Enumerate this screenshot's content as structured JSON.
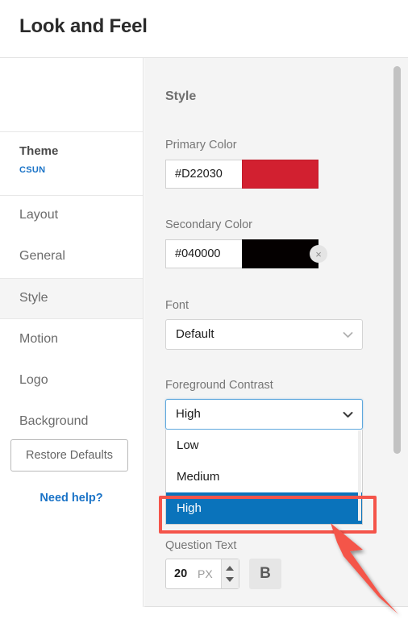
{
  "header": {
    "title": "Look and Feel"
  },
  "sidebar": {
    "theme": {
      "label": "Theme",
      "value": "CSUN"
    },
    "items": [
      {
        "label": "Layout",
        "selected": false
      },
      {
        "label": "General",
        "selected": false
      },
      {
        "label": "Style",
        "selected": true
      },
      {
        "label": "Motion",
        "selected": false
      },
      {
        "label": "Logo",
        "selected": false
      },
      {
        "label": "Background",
        "selected": false
      }
    ],
    "restore_defaults_label": "Restore Defaults",
    "need_help_label": "Need help?"
  },
  "panel": {
    "title": "Style",
    "primary_color": {
      "label": "Primary Color",
      "value": "#D22030",
      "swatch": "#D22030"
    },
    "secondary_color": {
      "label": "Secondary Color",
      "value": "#040000",
      "swatch": "#040000",
      "clear_icon": "×"
    },
    "font": {
      "label": "Font",
      "value": "Default"
    },
    "foreground_contrast": {
      "label": "Foreground Contrast",
      "value": "High",
      "options": [
        "Low",
        "Medium",
        "High"
      ],
      "highlighted_option": "High"
    },
    "question_text": {
      "label": "Question Text",
      "size": "20",
      "unit": "PX",
      "bold_label": "B"
    }
  },
  "annotation": {
    "color": "#F4544A",
    "target": "High"
  }
}
